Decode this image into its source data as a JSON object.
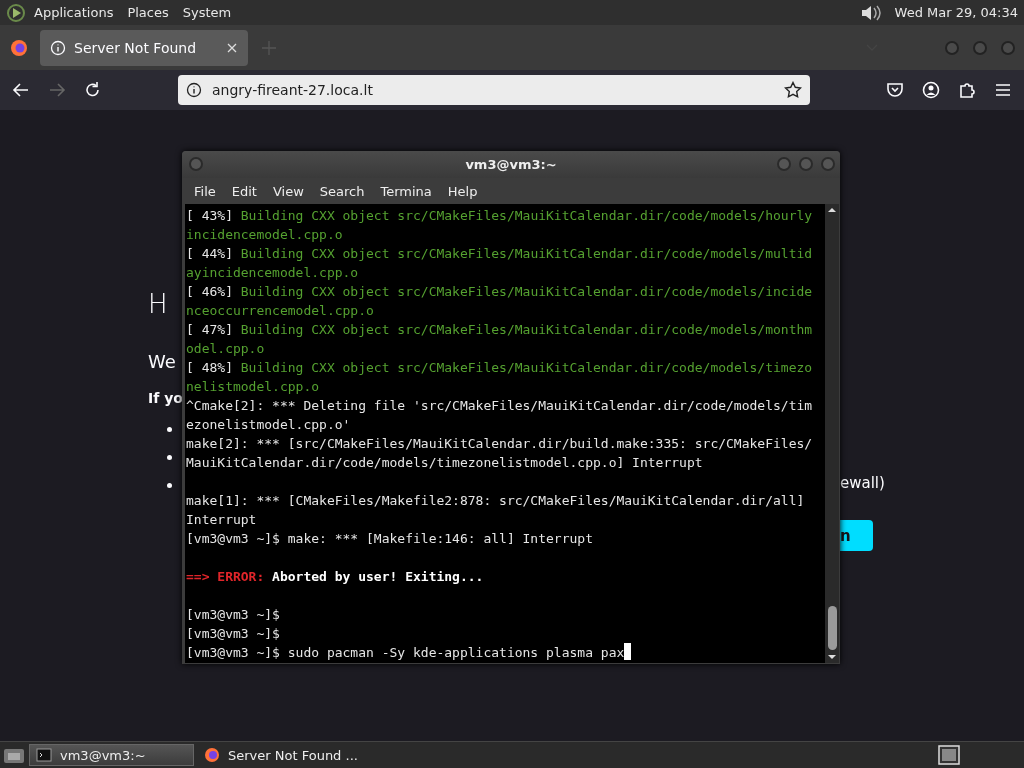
{
  "top_panel": {
    "menus": [
      "Applications",
      "Places",
      "System"
    ],
    "clock": "Wed Mar 29, 04:34"
  },
  "browser": {
    "tabs": [
      {
        "title": "Server Not Found",
        "selected": true
      }
    ],
    "url": "angry-fireant-27.loca.lt",
    "back_disabled": false,
    "forward_disabled": true
  },
  "page": {
    "heading": "H",
    "intro": "We",
    "bold_line": "If yo",
    "bullets": [
      {
        "kind": "dot"
      },
      {
        "kind": "dot"
      },
      {
        "kind": "dot"
      }
    ],
    "right_text": "ewall)",
    "button": "n"
  },
  "terminal": {
    "title": "vm3@vm3:~",
    "cursor": true,
    "menus": [
      "File",
      "Edit",
      "View",
      "Search",
      "Termina",
      "Help"
    ],
    "lines": [
      {
        "kind": "text",
        "segments": [
          {
            "kind": "plain",
            "text": "[ 43%] "
          },
          {
            "kind": "build",
            "text": "Building CXX object src/CMakeFiles/MauiKitCalendar.dir/code/models/hourly"
          }
        ]
      },
      {
        "kind": "text",
        "segments": [
          {
            "kind": "build",
            "text": "incidencemodel.cpp.o"
          }
        ]
      },
      {
        "kind": "text",
        "segments": [
          {
            "kind": "plain",
            "text": "[ 44%] "
          },
          {
            "kind": "build",
            "text": "Building CXX object src/CMakeFiles/MauiKitCalendar.dir/code/models/multid"
          }
        ]
      },
      {
        "kind": "text",
        "segments": [
          {
            "kind": "build",
            "text": "ayincidencemodel.cpp.o"
          }
        ]
      },
      {
        "kind": "text",
        "segments": [
          {
            "kind": "plain",
            "text": "[ 46%] "
          },
          {
            "kind": "build",
            "text": "Building CXX object src/CMakeFiles/MauiKitCalendar.dir/code/models/incide"
          }
        ]
      },
      {
        "kind": "text",
        "segments": [
          {
            "kind": "build",
            "text": "nceoccurrencemodel.cpp.o"
          }
        ]
      },
      {
        "kind": "text",
        "segments": [
          {
            "kind": "plain",
            "text": "[ 47%] "
          },
          {
            "kind": "build",
            "text": "Building CXX object src/CMakeFiles/MauiKitCalendar.dir/code/models/monthm"
          }
        ]
      },
      {
        "kind": "text",
        "segments": [
          {
            "kind": "build",
            "text": "odel.cpp.o"
          }
        ]
      },
      {
        "kind": "text",
        "segments": [
          {
            "kind": "plain",
            "text": "[ 48%] "
          },
          {
            "kind": "build",
            "text": "Building CXX object src/CMakeFiles/MauiKitCalendar.dir/code/models/timezo"
          }
        ]
      },
      {
        "kind": "text",
        "segments": [
          {
            "kind": "build",
            "text": "nelistmodel.cpp.o"
          }
        ]
      },
      {
        "kind": "text",
        "segments": [
          {
            "kind": "plain",
            "text": "^Cmake[2]: *** Deleting file 'src/CMakeFiles/MauiKitCalendar.dir/code/models/tim"
          }
        ]
      },
      {
        "kind": "text",
        "segments": [
          {
            "kind": "plain",
            "text": "ezonelistmodel.cpp.o'"
          }
        ]
      },
      {
        "kind": "text",
        "segments": [
          {
            "kind": "plain",
            "text": "make[2]: *** [src/CMakeFiles/MauiKitCalendar.dir/build.make:335: src/CMakeFiles/"
          }
        ]
      },
      {
        "kind": "text",
        "segments": [
          {
            "kind": "plain",
            "text": "MauiKitCalendar.dir/code/models/timezonelistmodel.cpp.o] Interrupt"
          }
        ]
      },
      {
        "kind": "blank"
      },
      {
        "kind": "text",
        "segments": [
          {
            "kind": "plain",
            "text": "make[1]: *** [CMakeFiles/Makefile2:878: src/CMakeFiles/MauiKitCalendar.dir/all]"
          }
        ]
      },
      {
        "kind": "text",
        "segments": [
          {
            "kind": "plain",
            "text": "Interrupt"
          }
        ]
      },
      {
        "kind": "text",
        "segments": [
          {
            "kind": "plain",
            "text": "[vm3@vm3 ~]$ make: *** [Makefile:146: all] Interrupt"
          }
        ]
      },
      {
        "kind": "blank"
      },
      {
        "kind": "text",
        "segments": [
          {
            "kind": "error",
            "text": "==> ERROR:"
          },
          {
            "kind": "bold",
            "text": " Aborted by user! Exiting..."
          }
        ]
      },
      {
        "kind": "blank"
      },
      {
        "kind": "text",
        "segments": [
          {
            "kind": "plain",
            "text": "[vm3@vm3 ~]$"
          }
        ]
      },
      {
        "kind": "text",
        "segments": [
          {
            "kind": "plain",
            "text": "[vm3@vm3 ~]$"
          }
        ]
      },
      {
        "kind": "text",
        "segments": [
          {
            "kind": "plain",
            "text": "[vm3@vm3 ~]$ sudo pacman -Sy kde-applications plasma pax"
          }
        ]
      }
    ]
  },
  "taskbar": {
    "tasks": [
      {
        "label": "vm3@vm3:~",
        "kind": "terminal",
        "selected": true
      },
      {
        "label": "Server Not Found ...",
        "kind": "browser",
        "selected": false
      }
    ]
  }
}
